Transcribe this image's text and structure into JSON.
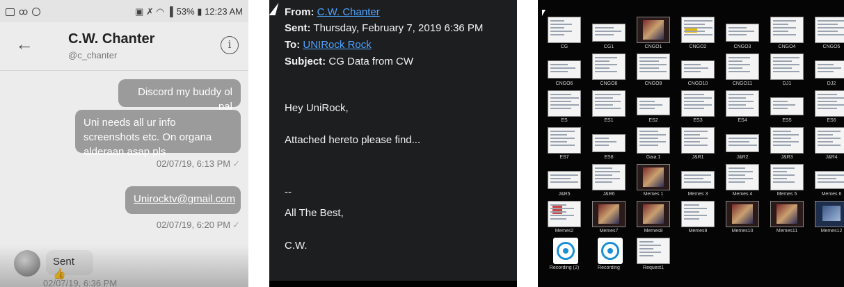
{
  "phone": {
    "status_right": "53% ▮ 12:23 AM",
    "status_icons": [
      "image-icon",
      "voicemail-icon",
      "circle-minus-icon"
    ],
    "contact_name": "C.W. Chanter",
    "contact_handle": "@c_chanter",
    "messages": [
      {
        "direction": "out",
        "text": "Discord my buddy ol pal"
      },
      {
        "direction": "out",
        "text": "Uni needs all ur info screenshots etc. On organa alderaan asap pls"
      },
      {
        "direction": "out",
        "text": "Unirocktv@gmail.com"
      },
      {
        "direction": "in",
        "text": "Sent 👍"
      }
    ],
    "timestamps": [
      "02/07/19, 6:13 PM",
      "02/07/19, 6:20 PM",
      "02/07/19, 6:36 PM"
    ],
    "tick": "✓"
  },
  "email": {
    "from_label": "From:",
    "from_value": "C.W. Chanter",
    "sent_label": "Sent:",
    "sent_value": "Thursday, February 7, 2019 6:36 PM",
    "to_label": "To:",
    "to_value": "UNIRock Rock",
    "subject_label": "Subject:",
    "subject_value": "CG Data from CW",
    "body": [
      "Hey UniRock,",
      "Attached hereto please find...",
      "--",
      "All The Best,",
      "C.W."
    ],
    "link_color": "#4fa3ff"
  },
  "files": [
    "CG",
    "CG1",
    "CNGO1",
    "CNGO2",
    "CNGO3",
    "CNGO4",
    "CNGO5",
    "CNGO6",
    "CNGO8",
    "CNGO9",
    "CNGO10",
    "CNGO11",
    "DJ1",
    "DJ2",
    "ES",
    "ES1",
    "ES2",
    "ES3",
    "ES4",
    "ES5",
    "ES6",
    "ES7",
    "ES8",
    "Gaia 1",
    "J&R1",
    "J&R2",
    "J&R3",
    "J&R4",
    "J&R5",
    "J&R6",
    "Memes 1",
    "Memes 3",
    "Memes 4",
    "Memes 5",
    "Memes 6",
    "Memes2",
    "Memes7",
    "Memes8",
    "Memes9",
    "Memes10",
    "Memes11",
    "Memes12",
    "Recording (2)",
    "Recording",
    "Request1"
  ]
}
